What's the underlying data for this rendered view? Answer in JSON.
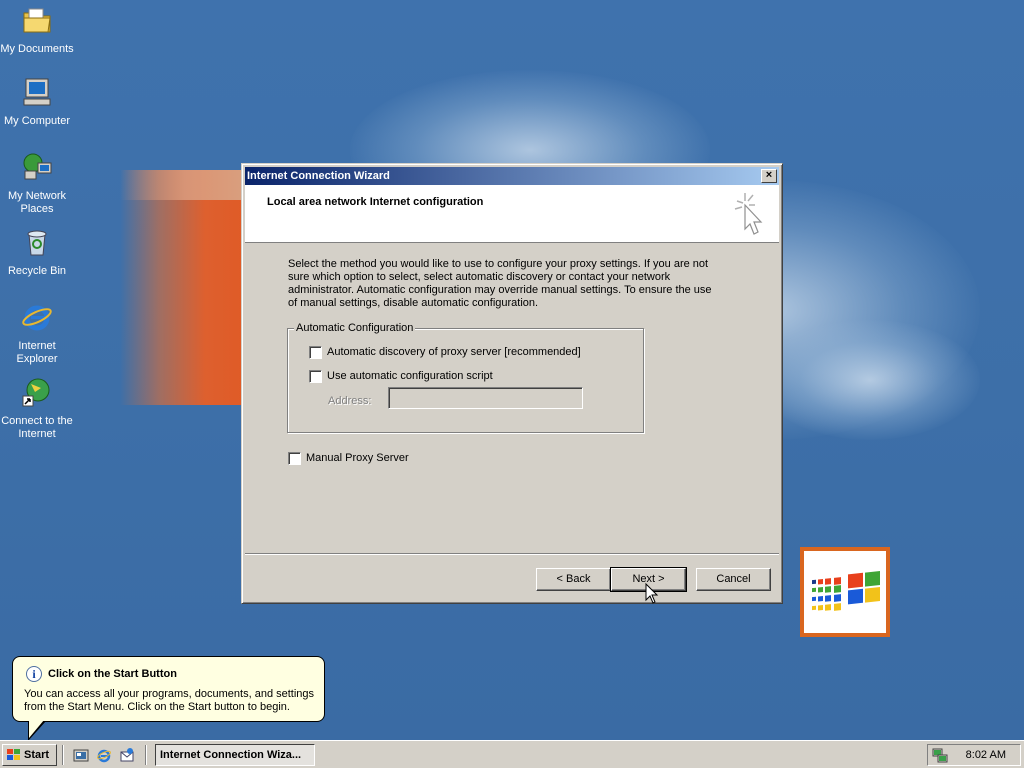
{
  "desktop": {
    "icons": [
      {
        "label": "My Documents",
        "icon": "my-documents-folder-icon"
      },
      {
        "label": "My Computer",
        "icon": "my-computer-icon"
      },
      {
        "label": "My Network Places",
        "icon": "network-places-icon"
      },
      {
        "label": "Recycle Bin",
        "icon": "recycle-bin-icon"
      },
      {
        "label": "Internet Explorer",
        "icon": "internet-explorer-icon"
      },
      {
        "label": "Connect to the Internet",
        "icon": "connect-internet-icon"
      }
    ]
  },
  "wizard": {
    "window_title": "Internet Connection Wizard",
    "close_glyph": "×",
    "page_title": "Local area network Internet configuration",
    "intro_text": "Select the method you would like to use to configure your proxy settings.  If you are not sure which option to select, select automatic discovery or contact your network administrator.  Automatic configuration may override manual settings.  To ensure the use of manual settings, disable automatic configuration.",
    "auto_config": {
      "legend": "Automatic Configuration",
      "auto_discovery_label": "Automatic discovery of proxy server [recommended]",
      "auto_discovery_checked": false,
      "auto_script_label": "Use automatic configuration script",
      "auto_script_checked": false,
      "address_label": "Address:",
      "address_value": ""
    },
    "manual_proxy_label": "Manual Proxy Server",
    "manual_proxy_checked": false,
    "buttons": {
      "back": "< Back",
      "next": "Next >",
      "cancel": "Cancel"
    }
  },
  "balloon": {
    "title": "Click on the Start Button",
    "text": "You can access all your programs, documents, and settings from the Start Menu. Click on the Start button to begin.",
    "icon": "info-icon"
  },
  "taskbar": {
    "start_label": "Start",
    "quick_launch": [
      "show-desktop-icon",
      "internet-explorer-icon",
      "outlook-express-icon"
    ],
    "task_button_label": "Internet Connection Wiza...",
    "clock": "8:02 AM",
    "tray_icon": "network-tray-icon"
  },
  "colors": {
    "desktop": "#3a6ea5",
    "titlebar_start": "#0a246a",
    "titlebar_end": "#a6caf0",
    "face": "#d4d0c8",
    "balloon": "#ffffe1",
    "logo_border": "#d9661f"
  }
}
